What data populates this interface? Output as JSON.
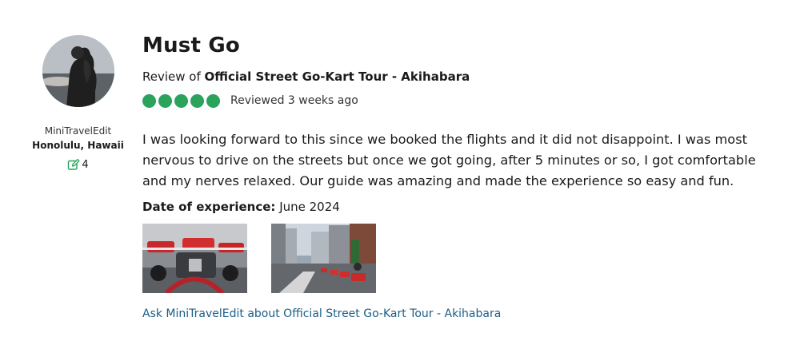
{
  "user": {
    "avatar_icon": "user-avatar-photo",
    "username": "MiniTravelEdit",
    "hometown": "Honolulu, Hawaii",
    "contributions": "4",
    "contrib_icon": "edit-icon"
  },
  "review": {
    "title": "Must Go",
    "review_of_prefix": "Review of",
    "place": "Official Street Go-Kart Tour - Akihabara",
    "rating": 5,
    "rating_color": "#2aa35c",
    "reviewed_when": "Reviewed 3 weeks ago",
    "body": "I was looking forward to this since we booked the flights and it did not disappoint. I was most nervous to drive on the streets but once we got going, after 5 minutes or so, I got comfortable and my nerves relaxed. Our guide was amazing and made the experience so easy and fun.",
    "date_label": "Date of experience:",
    "date_value": "June 2024",
    "photos": [
      "go-kart-closeup-photo",
      "street-kart-convoy-photo"
    ],
    "ask_link": "Ask MiniTravelEdit about Official Street Go-Kart Tour - Akihabara",
    "link_color": "#1b5e86"
  }
}
